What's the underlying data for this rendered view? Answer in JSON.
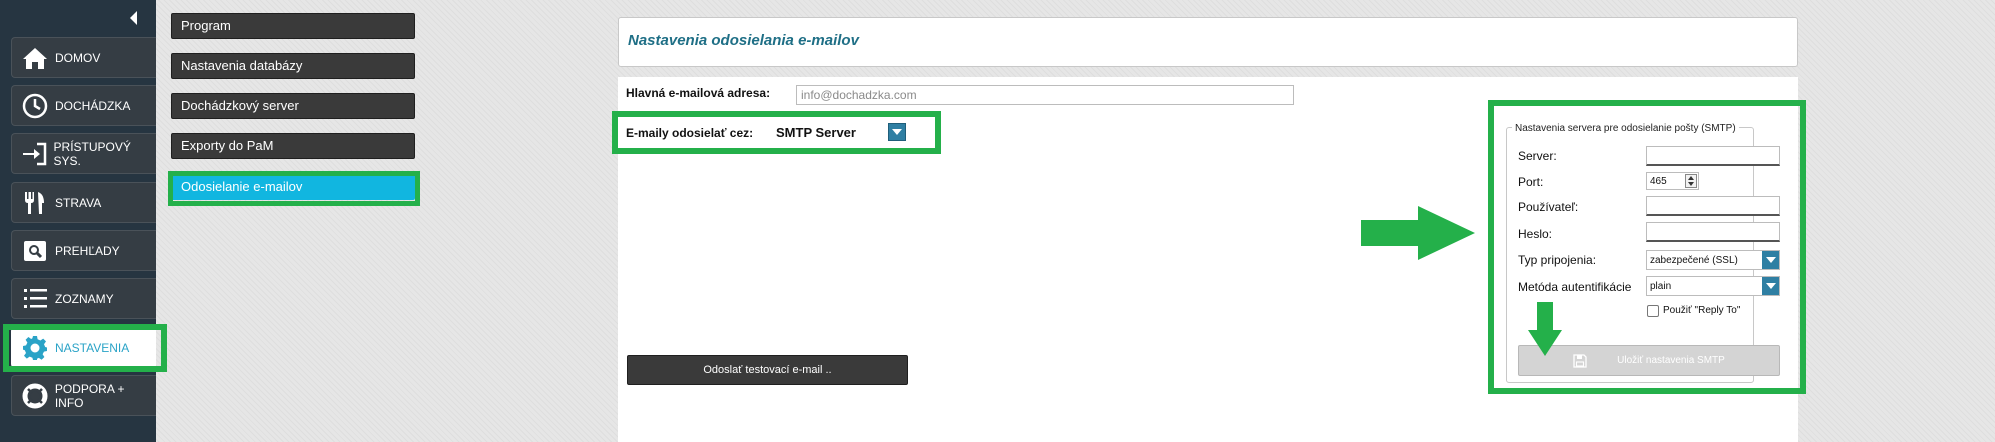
{
  "sidebar": {
    "items": [
      {
        "label": "DOMOV",
        "icon": "home-icon"
      },
      {
        "label": "DOCHÁDZKA",
        "icon": "clock-icon"
      },
      {
        "label": "PRÍSTUPOVÝ SYS.",
        "icon": "login-icon"
      },
      {
        "label": "STRAVA",
        "icon": "cutlery-icon"
      },
      {
        "label": "PREHĽADY",
        "icon": "search-icon"
      },
      {
        "label": "ZOZNAMY",
        "icon": "list-icon"
      },
      {
        "label": "NASTAVENIA",
        "icon": "gear-icon",
        "active": true
      },
      {
        "label": "PODPORA + INFO",
        "icon": "lifebuoy-icon"
      }
    ]
  },
  "submenu": {
    "items": [
      {
        "label": "Program"
      },
      {
        "label": "Nastavenia databázy"
      },
      {
        "label": "Dochádzkový server"
      },
      {
        "label": "Exporty do PaM"
      },
      {
        "label": "Odosielanie e-mailov",
        "active": true
      }
    ]
  },
  "main": {
    "title": "Nastavenia odosielania e-mailov",
    "main_email_label": "Hlavná e-mailová adresa:",
    "main_email_placeholder": "info@dochadzka.com",
    "send_via_label": "E-maily odosielať cez:",
    "send_via_value": "SMTP Server",
    "test_button": "Odoslať testovací e-mail .."
  },
  "smtp": {
    "legend": "Nastavenia servera pre odosielanie pošty (SMTP)",
    "server_label": "Server:",
    "server_value": "",
    "port_label": "Port:",
    "port_value": "465",
    "user_label": "Používateľ:",
    "user_value": "",
    "password_label": "Heslo:",
    "password_value": "",
    "connection_type_label": "Typ pripojenia:",
    "connection_type_value": "zabezpečené (SSL)",
    "auth_method_label": "Metóda autentifikácie",
    "auth_method_value": "plain",
    "reply_to_label": "Použiť \"Reply To\"",
    "reply_to_checked": false,
    "save_button": "Uložiť nastavenia SMTP"
  },
  "colors": {
    "sidebar_bg": "#263541",
    "accent": "#11b6e0",
    "highlight_green": "#24b04a",
    "select_button": "#2f7fa3"
  }
}
